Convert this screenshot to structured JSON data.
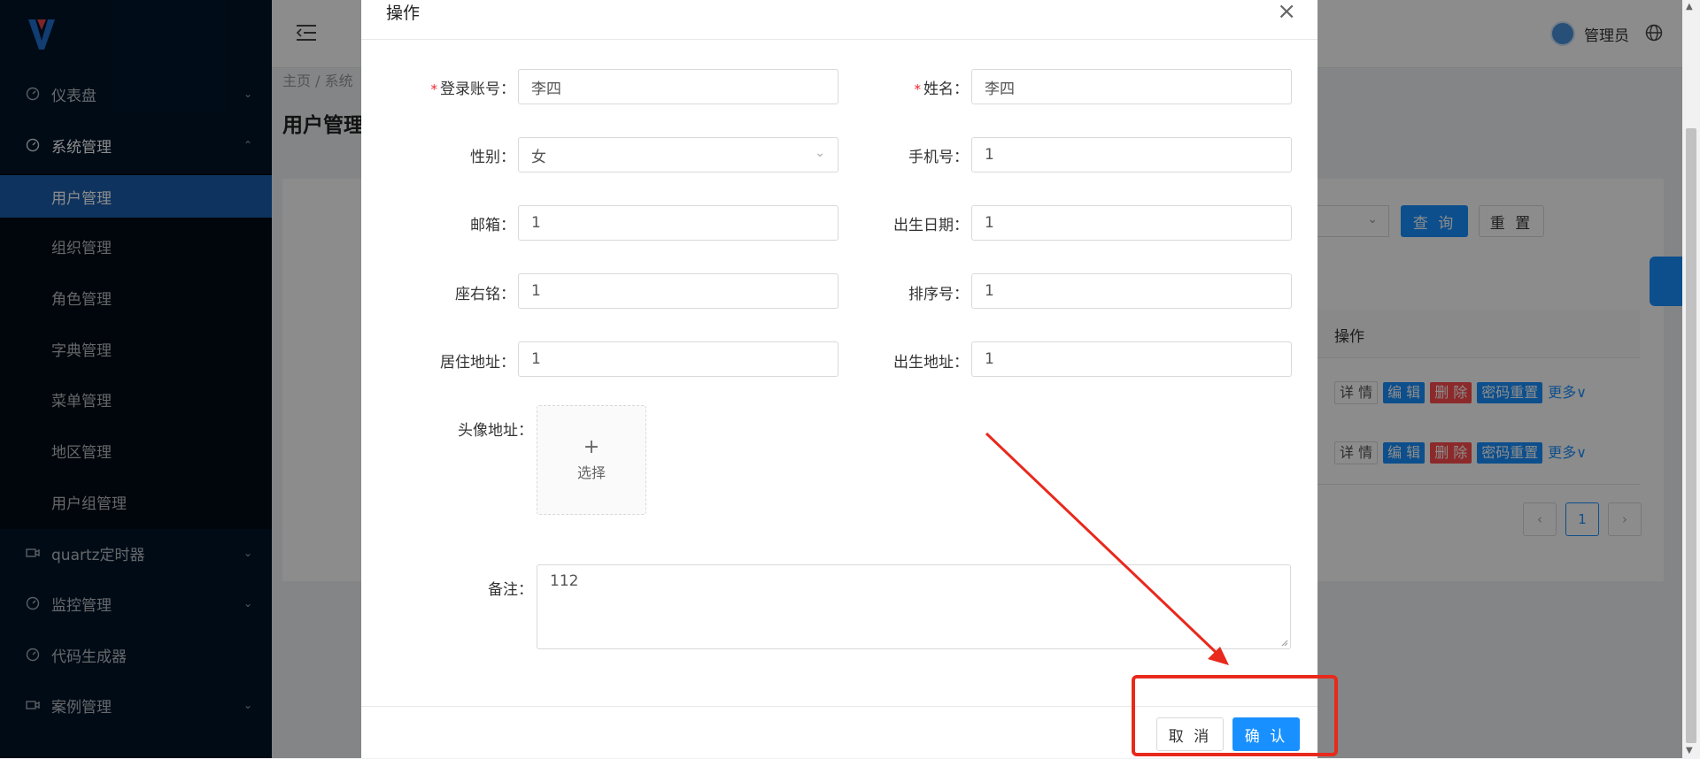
{
  "sidebar": {
    "items": [
      {
        "label": "仪表盘",
        "icon": "dashboard-icon"
      },
      {
        "label": "系统管理",
        "icon": "dashboard-icon"
      },
      {
        "label": "用户管理"
      },
      {
        "label": "组织管理"
      },
      {
        "label": "角色管理"
      },
      {
        "label": "字典管理"
      },
      {
        "label": "菜单管理"
      },
      {
        "label": "地区管理"
      },
      {
        "label": "用户组管理"
      },
      {
        "label": "quartz定时器",
        "icon": "video-icon"
      },
      {
        "label": "监控管理",
        "icon": "dashboard-icon"
      },
      {
        "label": "代码生成器",
        "icon": "dashboard-icon"
      },
      {
        "label": "案例管理",
        "icon": "video-icon"
      }
    ]
  },
  "header": {
    "username": "管理员",
    "breadcrumb": "主页 / 系统",
    "page_title": "用户管理"
  },
  "background": {
    "query_label": "查 询",
    "reset_label": "重 置",
    "table_header": "操作",
    "row_actions": {
      "detail": "详 情",
      "edit": "编 辑",
      "delete": "删 除",
      "reset_pwd": "密码重置",
      "more": "更多"
    },
    "current_page": "1"
  },
  "modal": {
    "title": "操作",
    "fields": {
      "login_account": {
        "label": "登录账号",
        "value": "李四",
        "required": true
      },
      "name": {
        "label": "姓名",
        "value": "李四",
        "required": true
      },
      "gender": {
        "label": "性别",
        "value": "女"
      },
      "phone": {
        "label": "手机号",
        "value": "1"
      },
      "email": {
        "label": "邮箱",
        "value": "1"
      },
      "birth_date": {
        "label": "出生日期",
        "value": "1"
      },
      "motto": {
        "label": "座右铭",
        "value": "1"
      },
      "sort_no": {
        "label": "排序号",
        "value": "1"
      },
      "residence": {
        "label": "居住地址",
        "value": "1"
      },
      "birthplace": {
        "label": "出生地址",
        "value": "1"
      },
      "avatar": {
        "label": "头像地址",
        "upload_label": "选择"
      },
      "remark": {
        "label": "备注",
        "value": "112"
      }
    },
    "cancel_label": "取 消",
    "ok_label": "确 认"
  },
  "colors": {
    "sidebar_bg": "#001529",
    "active_menu": "#1b5eab",
    "primary": "#1890ff",
    "danger": "#ff4d4f",
    "annotation": "#e8291c"
  }
}
